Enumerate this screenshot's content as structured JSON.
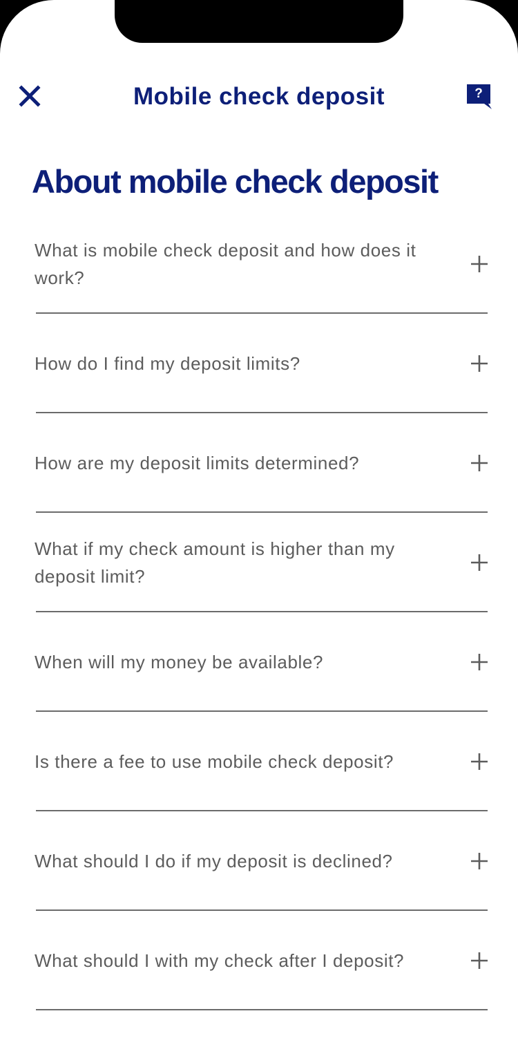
{
  "header": {
    "title": "Mobile check deposit",
    "close_icon": "close-icon",
    "help_icon": "help-chat-icon",
    "help_symbol": "?"
  },
  "page": {
    "heading": "About mobile check deposit"
  },
  "faq": {
    "items": [
      {
        "question": "What is mobile check deposit and how does it work?"
      },
      {
        "question": "How do I find my deposit limits?"
      },
      {
        "question": "How are my deposit limits determined?"
      },
      {
        "question": "What if my check amount is higher than my deposit limit?"
      },
      {
        "question": "When will my money be available?"
      },
      {
        "question": "Is there a fee to use mobile check deposit?"
      },
      {
        "question": "What should I do if my deposit is declined?"
      },
      {
        "question": "What should I with my check after I deposit?"
      }
    ],
    "expand_icon": "plus-icon"
  },
  "colors": {
    "brand": "#0d1f78",
    "text": "#5c5c5c",
    "divider": "#6b6b6b",
    "background": "#ffffff"
  }
}
